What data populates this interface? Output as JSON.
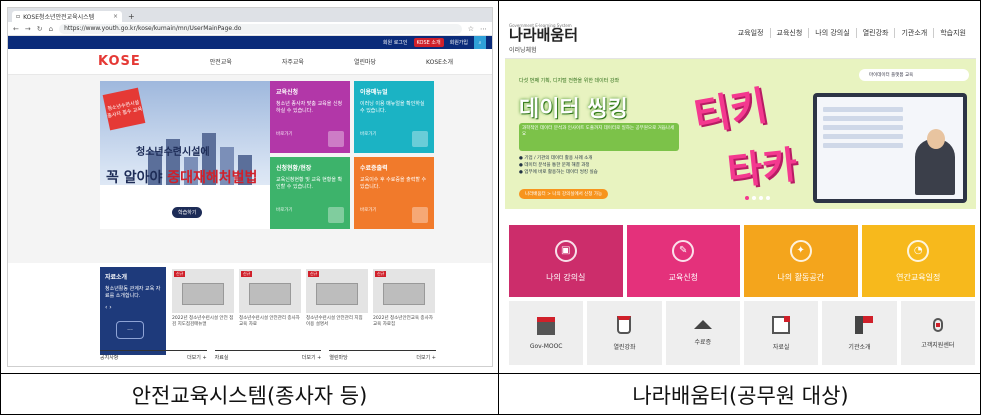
{
  "captions": {
    "left": "안전교육시스템(종사자 등)",
    "right": "나라배움터(공무원 대상)"
  },
  "left_browser": {
    "tab_title": "KOSE청소년안전교육시스템",
    "new_tab": "+",
    "url": "https://www.youth.go.kr/kose/kumain/mn/UserMainPage.do",
    "utility_links": [
      "회원 로그인",
      "KOSE 소개",
      "회원가입"
    ],
    "logo": "KOSE",
    "logo_sub": "청소년안전교육시스템",
    "nav": [
      "안전교육",
      "자주교육",
      "열린마당",
      "KOSE소개"
    ],
    "banner": {
      "badge": "청소년수련시설 종사자 필수 교육",
      "line1": "청소년수련시설에",
      "line2_pre": "꼭 알아야 ",
      "line2_em": "중대재해처벌법",
      "button": "학습하기"
    },
    "tiles": [
      {
        "title": "교육신청",
        "desc": "청소년 종사자 맞춤 교육을 신청하실 수 있습니다.",
        "more": "바로가기",
        "color": "#b237a8"
      },
      {
        "title": "이용매뉴얼",
        "desc": "이러닝 이용 매뉴얼을 확인하실 수 있습니다.",
        "more": "바로가기",
        "color": "#1bb3c4"
      },
      {
        "title": "신청현황/현장",
        "desc": "교육신청현황 및 교육 현황을 확인할 수 있습니다.",
        "more": "바로가기",
        "color": "#3db36b"
      },
      {
        "title": "수료증출력",
        "desc": "교육이수 후 수료증을 출력할 수 있습니다.",
        "more": "바로가기",
        "color": "#f17a2b"
      }
    ],
    "notice": {
      "title": "자료소개",
      "desc": "청소년활동 관계자 교육 자료를 소개합니다.",
      "arrows": "‹ ›"
    },
    "thumbs": [
      {
        "tag": "신규",
        "caption": "2022년 청소년수련시설 안전 점검 지도점검매뉴얼"
      },
      {
        "tag": "신규",
        "caption": "청소년수련시설 안전관리 종사자 교육 자료"
      },
      {
        "tag": "신규",
        "caption": "청소년수련시설 안전관리 지침 이용 설명서"
      },
      {
        "tag": "신규",
        "caption": "2022년 청소년안전교육 종사자 교육 자료집"
      }
    ],
    "bottom_tabs": [
      {
        "label": "공지사항",
        "more": "더보기 +"
      },
      {
        "label": "자료실",
        "more": "더보기 +"
      },
      {
        "label": "열린마당",
        "more": "더보기 +"
      }
    ]
  },
  "right_site": {
    "logo": "나라배움터",
    "logo_sub": "Government E-learning System",
    "sub_link": "이러닝체험",
    "menu": [
      "교육일정",
      "교육신청",
      "나의 강의실",
      "열린강좌",
      "기관소개",
      "학습지원"
    ],
    "hero": {
      "pre": "다섯 번째 기획, 디지털 전환을 위한 데이터 강좌",
      "title": "데이터 씽킹",
      "pill": "과학적인 데이터 분석과 인사이트 도출까지 데이터로 일하는 공무원으로 거듭나세요",
      "list": [
        "● 기업 / 기관의 데이터 활용 사례 소개",
        "● 데이터 분석을 통한 문제 해결 과정",
        "● 업무에 바로 활용하는 데이터 씽킹 실습"
      ],
      "orange": "나라배움터 > 나의 강의실에서 신청 가능",
      "tiki1": "티키",
      "tiki2": "타카",
      "topbar": "마이데이터 플랫폼 교육"
    },
    "tiles": [
      {
        "label": "나의 강의실",
        "icon": "▣",
        "color": "#cc2d6b"
      },
      {
        "label": "교육신청",
        "icon": "✎",
        "color": "#e4317b"
      },
      {
        "label": "나의 활동공간",
        "icon": "✦",
        "color": "#f4a51c"
      },
      {
        "label": "연간교육일정",
        "icon": "◔",
        "color": "#f7b91c"
      }
    ],
    "icons": [
      {
        "label": "Gov-MOOC",
        "glyph": "book"
      },
      {
        "label": "열린강좌",
        "glyph": "cup"
      },
      {
        "label": "수료증",
        "glyph": "cap"
      },
      {
        "label": "자료실",
        "glyph": "doc"
      },
      {
        "label": "기관소개",
        "glyph": "flag"
      },
      {
        "label": "고객지원센터",
        "glyph": "mic"
      }
    ]
  }
}
